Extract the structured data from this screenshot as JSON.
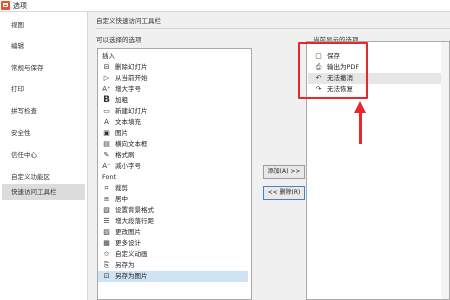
{
  "window": {
    "title": "选项",
    "icon": "app-logo-icon",
    "accent": "#e8542f"
  },
  "sidebar": {
    "items": [
      {
        "label": "视图"
      },
      {
        "label": "编辑"
      },
      {
        "label": "常规与保存"
      },
      {
        "label": "打印"
      },
      {
        "label": "拼写检查"
      },
      {
        "label": "安全性"
      },
      {
        "label": "信任中心"
      },
      {
        "label": "自定义功能区"
      },
      {
        "label": "快速访问工具栏",
        "active": true
      }
    ]
  },
  "panel": {
    "title": "自定义快速访问工具栏",
    "available_label": "可以选择的选项",
    "current_label": "当前显示的选项"
  },
  "available_commands": [
    {
      "label": "插入",
      "icon": ""
    },
    {
      "label": "删除幻灯片",
      "icon": "delete-slide-icon"
    },
    {
      "label": "从当前开始",
      "icon": "play-from-current-icon"
    },
    {
      "label": "增大字号",
      "icon": "increase-font-icon"
    },
    {
      "label": "加粗",
      "icon": "bold-icon"
    },
    {
      "label": "新建幻灯片",
      "icon": "new-slide-icon"
    },
    {
      "label": "文本填充",
      "icon": "text-fill-icon"
    },
    {
      "label": "图片",
      "icon": "picture-icon"
    },
    {
      "label": "横向文本框",
      "icon": "textbox-icon"
    },
    {
      "label": "格式刷",
      "icon": "format-painter-icon"
    },
    {
      "label": "减小字号",
      "icon": "decrease-font-icon"
    },
    {
      "label": "Font",
      "icon": ""
    },
    {
      "label": "裁剪",
      "icon": "crop-icon"
    },
    {
      "label": "居中",
      "icon": "center-align-icon"
    },
    {
      "label": "设置背景格式",
      "icon": "background-format-icon"
    },
    {
      "label": "增大段落行距",
      "icon": "line-spacing-icon"
    },
    {
      "label": "更改图片",
      "icon": "change-picture-icon"
    },
    {
      "label": "更多设计",
      "icon": "more-design-icon"
    },
    {
      "label": "自定义动画",
      "icon": "custom-animation-icon"
    },
    {
      "label": "另存为",
      "icon": "save-as-icon"
    },
    {
      "label": "另存为图片",
      "icon": "save-as-picture-icon"
    }
  ],
  "buttons": {
    "add": "添加(A) >>",
    "remove": "<< 删除(R)"
  },
  "current_commands": [
    {
      "label": "保存",
      "icon": "save-icon"
    },
    {
      "label": "输出为PDF",
      "icon": "pdf-export-icon"
    },
    {
      "label": "无法撤消",
      "icon": "undo-icon"
    },
    {
      "label": "无法恢复",
      "icon": "redo-icon"
    }
  ],
  "annotation": {
    "color": "#e8262c"
  }
}
